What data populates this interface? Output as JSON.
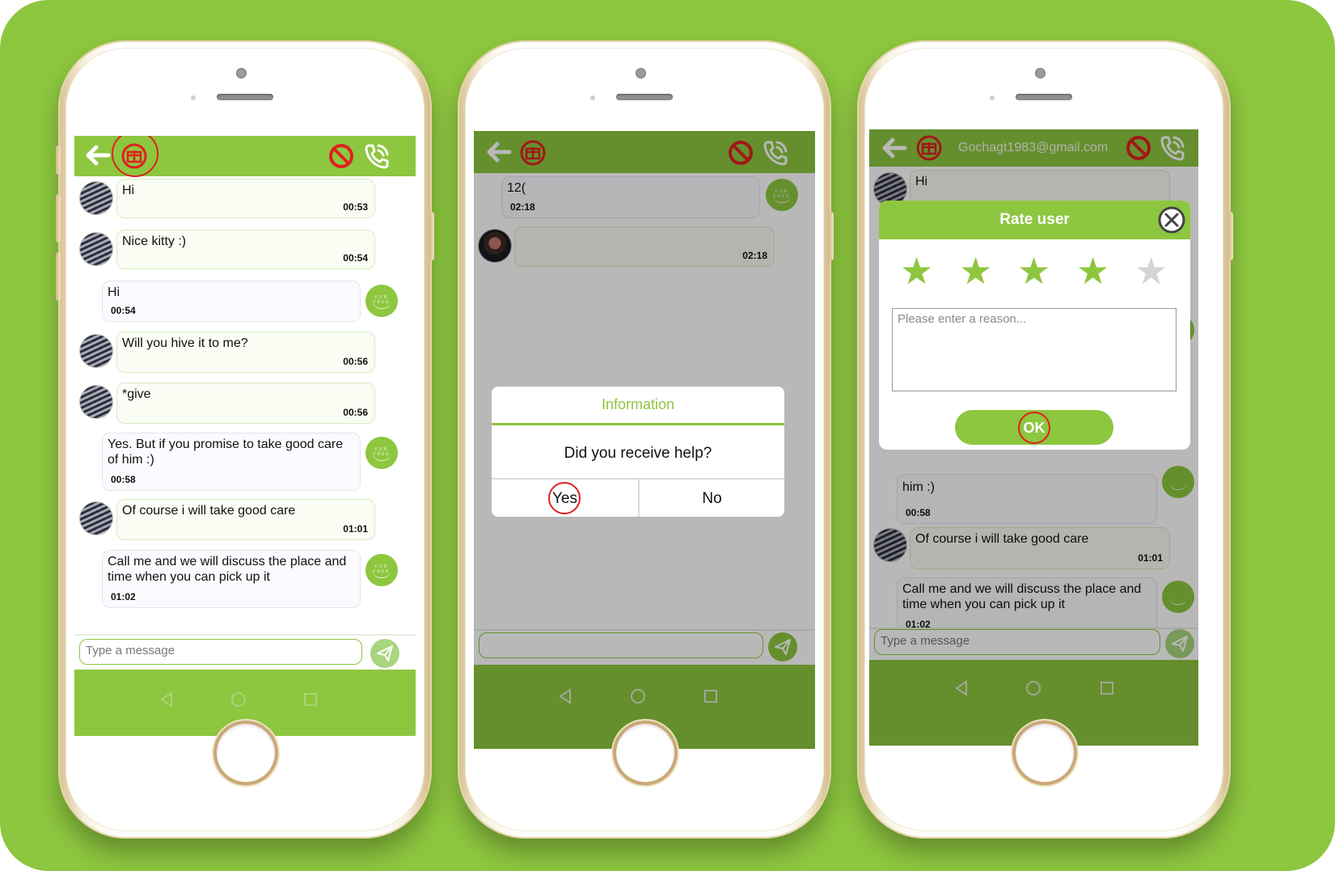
{
  "colors": {
    "brand_green": "#8dc63f",
    "background_green": "#8dc63f",
    "highlight_red": "#e02020",
    "star_inactive": "#d4d4d4"
  },
  "icons": [
    "back-arrow-icon",
    "gift-icon",
    "block-icon",
    "phone-call-icon",
    "send-icon",
    "nav-back-icon",
    "nav-home-icon",
    "nav-recent-icon",
    "close-icon",
    "star-icon"
  ],
  "screen1": {
    "messages": [
      {
        "from": "other",
        "text": "Hi",
        "time": "00:53"
      },
      {
        "from": "other",
        "text": "Nice kitty :)",
        "time": "00:54"
      },
      {
        "from": "me",
        "text": "Hi",
        "time": "00:54"
      },
      {
        "from": "other",
        "text": "Will you hive it to me?",
        "time": "00:56"
      },
      {
        "from": "other",
        "text": "*give",
        "time": "00:56"
      },
      {
        "from": "me",
        "text": "Yes. But if you promise to take good care of him :)",
        "time": "00:58"
      },
      {
        "from": "other",
        "text": "Of course  i will take good care",
        "time": "01:01"
      },
      {
        "from": "me",
        "text": "Call me and we will discuss the place and time when you can pick up it",
        "time": "01:02"
      }
    ],
    "input_placeholder": "Type a message",
    "avatar_label": "FOR FREE"
  },
  "screen2": {
    "messages": [
      {
        "from": "other",
        "text": "12(",
        "time": "02:18"
      },
      {
        "from": "other",
        "text": "",
        "time": "02:18"
      }
    ],
    "dialog": {
      "title": "Information",
      "question": "Did you receive help?",
      "yes_label": "Yes",
      "no_label": "No"
    }
  },
  "screen3": {
    "header_email": "Gochagt1983@gmail.com",
    "background_messages": [
      {
        "text": "Hi"
      },
      {
        "text": "him :)",
        "time": "00:58"
      },
      {
        "text": "Of course  i will take good care",
        "time": "01:01"
      },
      {
        "text": "Call me and we will discuss the place and time when you can pick up it",
        "time": "01:02"
      }
    ],
    "input_placeholder": "Type a message",
    "rate_dialog": {
      "title": "Rate user",
      "rating": 4,
      "max_rating": 5,
      "reason_placeholder": "Please enter a reason...",
      "ok_label": "OK"
    }
  }
}
